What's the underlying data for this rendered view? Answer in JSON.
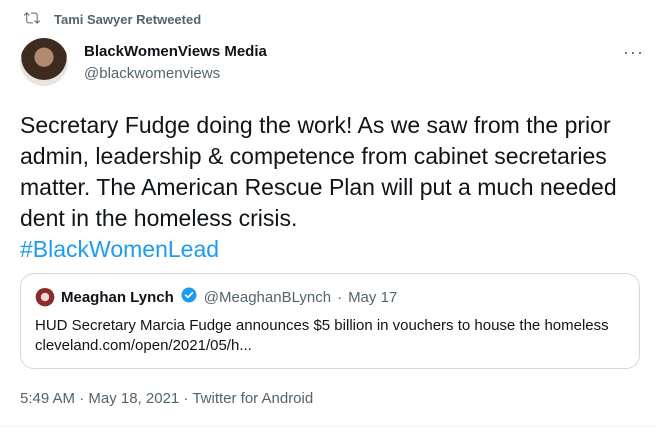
{
  "retweet": {
    "label": "Tami Sawyer Retweeted",
    "icon": "retweet-icon"
  },
  "author": {
    "display_name": "BlackWomenViews Media",
    "handle": "@blackwomenviews"
  },
  "tweet": {
    "text": "Secretary Fudge doing the work! As we saw from the prior admin, leadership & competence from cabinet secretaries matter. The American Rescue Plan will put a much needed dent in the homeless crisis.",
    "hashtag": "#BlackWomenLead"
  },
  "quoted": {
    "display_name": "Meaghan Lynch",
    "handle": "@MeaghanBLynch",
    "separator": "·",
    "date": "May 17",
    "text": "HUD Secretary Marcia Fudge announces $5 billion in vouchers to house the homeless cleveland.com/open/2021/05/h..."
  },
  "meta": {
    "time": "5:49 AM · May 18, 2021 · Twitter for Android"
  },
  "more_label": "···",
  "colors": {
    "accent": "#1d9bf0",
    "muted": "#536471",
    "text": "#0f1419",
    "border": "#cfd9de"
  }
}
